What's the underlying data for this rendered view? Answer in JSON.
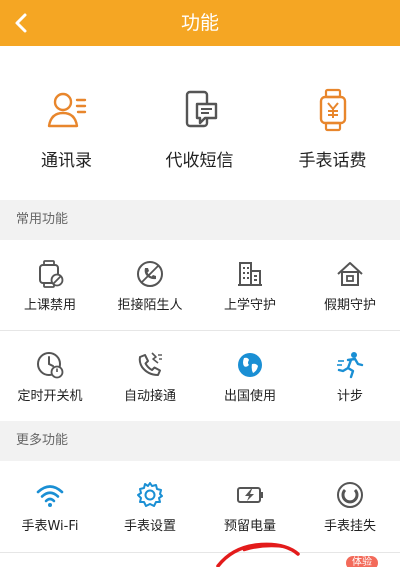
{
  "header": {
    "title": "功能",
    "back_icon": "chevron-left-icon"
  },
  "top": {
    "items": [
      {
        "label": "通讯录",
        "icon": "contacts-icon"
      },
      {
        "label": "代收短信",
        "icon": "sms-phone-icon"
      },
      {
        "label": "手表话费",
        "icon": "watch-yuan-icon"
      }
    ]
  },
  "common": {
    "title": "常用功能",
    "items": [
      {
        "label": "上课禁用",
        "icon": "watch-disable-icon"
      },
      {
        "label": "拒接陌生人",
        "icon": "phone-block-icon"
      },
      {
        "label": "上学守护",
        "icon": "school-building-icon"
      },
      {
        "label": "假期守护",
        "icon": "home-icon"
      },
      {
        "label": "定时开关机",
        "icon": "clock-power-icon"
      },
      {
        "label": "自动接通",
        "icon": "phone-auto-icon"
      },
      {
        "label": "出国使用",
        "icon": "globe-icon"
      },
      {
        "label": "计步",
        "icon": "runner-icon"
      }
    ]
  },
  "more": {
    "title": "更多功能",
    "items": [
      {
        "label": "手表Wi-Fi",
        "icon": "wifi-icon"
      },
      {
        "label": "手表设置",
        "icon": "gear-icon"
      },
      {
        "label": "预留电量",
        "icon": "battery-charge-icon"
      },
      {
        "label": "手表挂失",
        "icon": "report-loss-icon"
      }
    ]
  },
  "bottom": {
    "badge": "体验"
  },
  "colors": {
    "accent": "#f5a623",
    "icon_blue": "#1a8fd4",
    "icon_gray": "#555555",
    "icon_orange": "#e8862c",
    "scribble": "#e31b1b"
  }
}
